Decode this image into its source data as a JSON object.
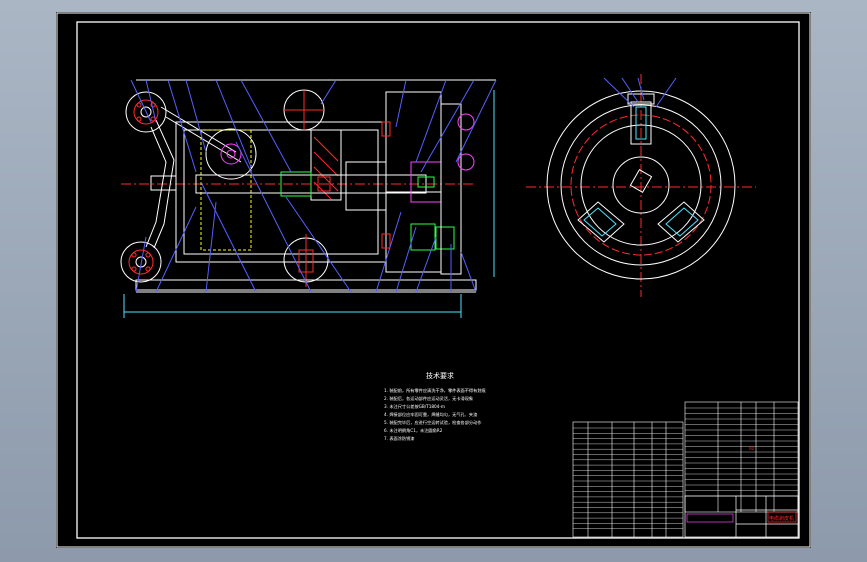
{
  "drawing": {
    "technical_requirements_title": "技术要求",
    "notes": [
      "1. 装配前，所有零件应清洗干净，零件表面不得有划痕",
      "2. 装配后，各运动部件应运动灵活，无卡滞现象",
      "3. 未注尺寸公差按GB/T1804-m",
      "4. 焊接部位应牢固可靠，焊缝均匀，无气孔、夹渣",
      "5. 装配完毕后，应进行空运转试验，检查各部分动作",
      "6. 未注明倒角C1，未注圆角R2",
      "7. 表面涂防锈漆"
    ],
    "title_block_name": "电缆剥皮机",
    "title_block_code": "00"
  },
  "colors": {
    "frame": "#ffffff",
    "outline": "#ffffff",
    "center_line": "#ff2a2a",
    "section": "#ff2a2a",
    "hidden": "#ffff00",
    "dimension": "#4fe3ff",
    "part_green": "#2bff4a",
    "leader": "#5560ff",
    "gear": "#ff40ff"
  }
}
